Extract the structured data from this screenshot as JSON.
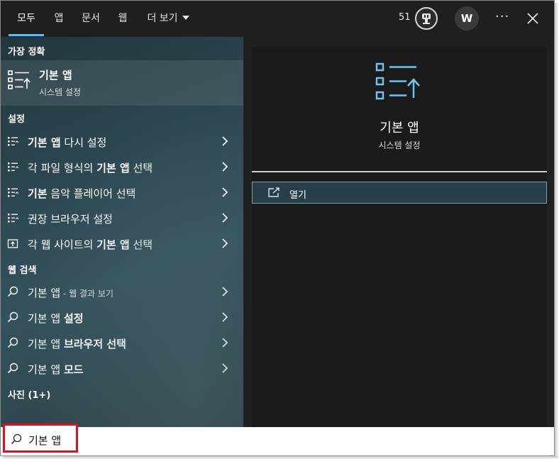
{
  "tabs": [
    "모두",
    "앱",
    "문서",
    "웹",
    "더 보기"
  ],
  "points": "51",
  "user_initial": "W",
  "more_options": "···",
  "sections": {
    "best": "가장 정확",
    "settings": "설정",
    "web": "웹 검색",
    "photos": "사진 (1+)"
  },
  "best_match": {
    "title": "기본 앱",
    "subtitle": "시스템 설정",
    "icon": "default-apps-icon"
  },
  "settings_items": [
    {
      "bold1": "기본 앱",
      "rest": " 다시 설정",
      "icon": "list-settings-icon"
    },
    {
      "pre": "각 파일 형식의 ",
      "bold": "기본 앱",
      "post": " 선택",
      "icon": "list-settings-icon"
    },
    {
      "bold1": "기본",
      "rest": " 음악 플레이어 선택",
      "icon": "list-settings-icon"
    },
    {
      "plain": "권장 브라우저 설정",
      "icon": "list-settings-icon"
    },
    {
      "pre": "각 웹 사이트의 ",
      "bold": "기본 앱",
      "post": " 선택",
      "icon": "web-default-icon"
    }
  ],
  "web_items": [
    {
      "plain": "기본 앱",
      "small": " - 웹 결과 보기"
    },
    {
      "plain": "기본 앱 ",
      "bold": "설정"
    },
    {
      "plain": "기본 앱 ",
      "bold": "브라우저 선택"
    },
    {
      "plain": "기본 앱 ",
      "bold": "모드"
    }
  ],
  "preview": {
    "title": "기본 앱",
    "subtitle": "시스템 설정",
    "open_label": "열기"
  },
  "search": {
    "query": "기본 앱"
  },
  "colors": {
    "accent": "#4cc2ff",
    "highlight_border": "#e0101a",
    "icon_blue": "#6cc4f0"
  }
}
